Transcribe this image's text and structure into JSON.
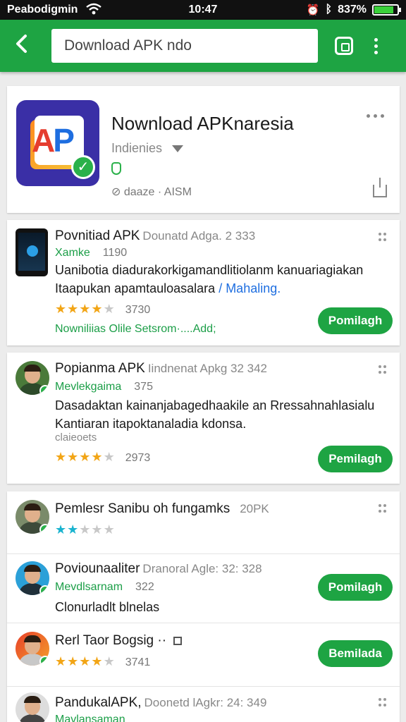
{
  "status_bar": {
    "carrier": "Peabodigmin",
    "time": "10:47",
    "battery": "837%",
    "battery_level_percent": 83
  },
  "toolbar": {
    "search_value": "Download APK ndo"
  },
  "header": {
    "title": "Nownload APKnaresia",
    "category": "Indienies",
    "meta": "daaze · AISM"
  },
  "rows": [
    {
      "title": "Povnitiad APK",
      "subtitle": "Dounatd Adga. 2 333",
      "developer": "Xamke",
      "size": "1190",
      "desc_line1": "Uanibotia diadurakorkigamandlitiolanm kanuariagiakan",
      "desc_line2": "Itaapukan apamtauloasalara",
      "desc_link": "/ Mahaling.",
      "rating_stars": 3.5,
      "rating_count": "3730",
      "links": "Nowniliias Olile  Setsrom·....Add;",
      "button": "Pomilagh"
    },
    {
      "title": "Popianma APK",
      "subtitle": "Iindnenat Apkg 32 342",
      "developer": "Mevlekgaima",
      "size": "375",
      "desc_line1": "Dasadaktan kainanjabagedhaakile an Rressahnahlasialu",
      "desc_line2": "Kantiaran itapoktanaladia kdonsa.",
      "category": "claieoets",
      "rating_stars": 3.5,
      "rating_count": "2973",
      "button": "Pemilagh"
    },
    {
      "title": "Pemlesr Sanibu oh fungamks",
      "size": "20PK",
      "rating_stars": 2
    },
    {
      "title": "Poviounaaliter",
      "subtitle": "Dranoral Agle: 32: 328",
      "developer": "Mevdlsarnam",
      "size": "322",
      "desc_line1": "Clonurladlt blnelas",
      "button": "Pomilagh"
    },
    {
      "title": "Rerl Taor Bogsig ··",
      "rating_stars": 4,
      "rating_count": "3741",
      "button": "Bemilada"
    },
    {
      "title": "PandukalAPK,",
      "subtitle": "Doonetd lAgkr: 24: 349",
      "developer": "Mavlansaman"
    }
  ]
}
